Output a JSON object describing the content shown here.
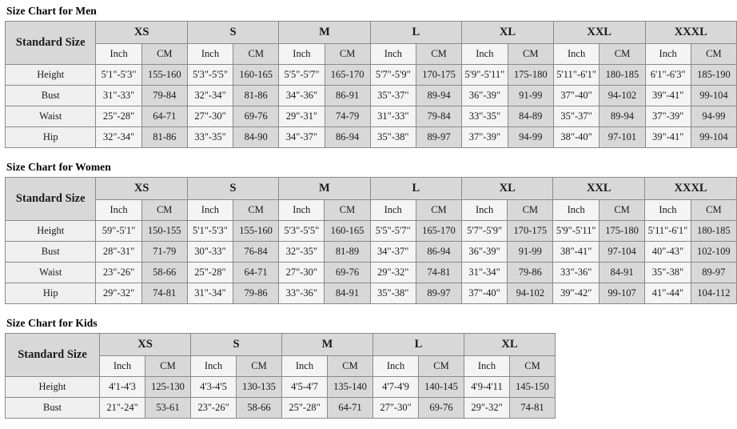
{
  "units": [
    "Inch",
    "CM"
  ],
  "corner_label": "Standard Size",
  "sections": [
    {
      "title": "Size Chart for Men",
      "sizes": [
        "XS",
        "S",
        "M",
        "L",
        "XL",
        "XXL",
        "XXXL"
      ],
      "rows": [
        {
          "label": "Height",
          "cells": [
            "5'1\"-5'3\"",
            "155-160",
            "5'3\"-5'5\"",
            "160-165",
            "5'5\"-5'7\"",
            "165-170",
            "5'7\"-5'9\"",
            "170-175",
            "5'9\"-5'11\"",
            "175-180",
            "5'11\"-6'1\"",
            "180-185",
            "6'1\"-6'3\"",
            "185-190"
          ]
        },
        {
          "label": "Bust",
          "cells": [
            "31\"-33\"",
            "79-84",
            "32\"-34\"",
            "81-86",
            "34\"-36\"",
            "86-91",
            "35\"-37\"",
            "89-94",
            "36\"-39\"",
            "91-99",
            "37\"-40\"",
            "94-102",
            "39\"-41\"",
            "99-104"
          ]
        },
        {
          "label": "Waist",
          "cells": [
            "25\"-28\"",
            "64-71",
            "27\"-30\"",
            "69-76",
            "29\"-31\"",
            "74-79",
            "31\"-33\"",
            "79-84",
            "33\"-35\"",
            "84-89",
            "35\"-37\"",
            "89-94",
            "37\"-39\"",
            "94-99"
          ]
        },
        {
          "label": "Hip",
          "cells": [
            "32\"-34\"",
            "81-86",
            "33\"-35\"",
            "84-90",
            "34\"-37\"",
            "86-94",
            "35\"-38\"",
            "89-97",
            "37\"-39\"",
            "94-99",
            "38\"-40\"",
            "97-101",
            "39\"-41\"",
            "99-104"
          ]
        }
      ]
    },
    {
      "title": "Size Chart for Women",
      "sizes": [
        "XS",
        "S",
        "M",
        "L",
        "XL",
        "XXL",
        "XXXL"
      ],
      "rows": [
        {
          "label": "Height",
          "cells": [
            "59\"-5'1\"",
            "150-155",
            "5'1\"-5'3\"",
            "155-160",
            "5'3\"-5'5\"",
            "160-165",
            "5'5\"-5'7\"",
            "165-170",
            "5'7\"-5'9\"",
            "170-175",
            "5'9\"-5'11\"",
            "175-180",
            "5'11\"-6'1\"",
            "180-185"
          ]
        },
        {
          "label": "Bust",
          "cells": [
            "28\"-31\"",
            "71-79",
            "30\"-33\"",
            "76-84",
            "32\"-35\"",
            "81-89",
            "34\"-37\"",
            "86-94",
            "36\"-39\"",
            "91-99",
            "38\"-41\"",
            "97-104",
            "40\"-43\"",
            "102-109"
          ]
        },
        {
          "label": "Waist",
          "cells": [
            "23\"-26\"",
            "58-66",
            "25\"-28\"",
            "64-71",
            "27\"-30\"",
            "69-76",
            "29\"-32\"",
            "74-81",
            "31\"-34\"",
            "79-86",
            "33\"-36\"",
            "84-91",
            "35\"-38\"",
            "89-97"
          ]
        },
        {
          "label": "Hip",
          "cells": [
            "29\"-32\"",
            "74-81",
            "31\"-34\"",
            "79-86",
            "33\"-36\"",
            "84-91",
            "35\"-38\"",
            "89-97",
            "37\"-40\"",
            "94-102",
            "39\"-42\"",
            "99-107",
            "41\"-44\"",
            "104-112"
          ]
        }
      ]
    },
    {
      "title": "Size Chart for Kids",
      "sizes": [
        "XS",
        "S",
        "M",
        "L",
        "XL"
      ],
      "rows": [
        {
          "label": "Height",
          "cells": [
            "4'1-4'3",
            "125-130",
            "4'3-4'5",
            "130-135",
            "4'5-4'7",
            "135-140",
            "4'7-4'9",
            "140-145",
            "4'9-4'11",
            "145-150"
          ]
        },
        {
          "label": "Bust",
          "cells": [
            "21\"-24\"",
            "53-61",
            "23\"-26\"",
            "58-66",
            "25\"-28\"",
            "64-71",
            "27\"-30\"",
            "69-76",
            "29\"-32\"",
            "74-81"
          ]
        }
      ]
    }
  ]
}
